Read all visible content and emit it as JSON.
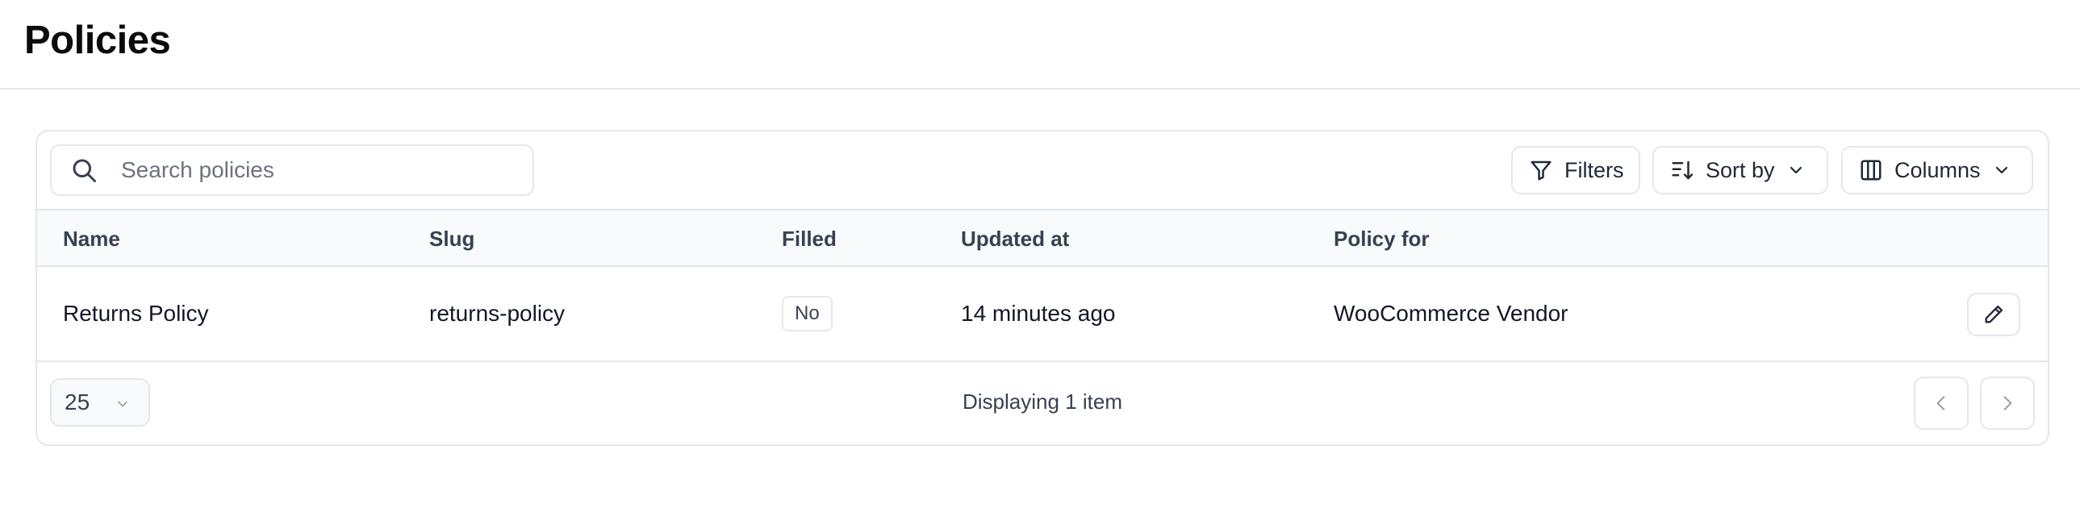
{
  "page": {
    "title": "Policies"
  },
  "toolbar": {
    "search_placeholder": "Search policies",
    "filters_label": "Filters",
    "sort_label": "Sort by",
    "columns_label": "Columns"
  },
  "table": {
    "columns": [
      "Name",
      "Slug",
      "Filled",
      "Updated at",
      "Policy for"
    ],
    "rows": [
      {
        "name": "Returns Policy",
        "slug": "returns-policy",
        "filled": "No",
        "updated_at": "14 minutes ago",
        "policy_for": "WooCommerce Vendor"
      }
    ]
  },
  "footer": {
    "per_page": "25",
    "count_text": "Displaying 1 item"
  },
  "icons": {
    "search": "search-icon",
    "filters": "filter-icon",
    "sort": "sort-icon",
    "columns": "columns-icon",
    "edit": "pencil-icon",
    "prev": "chevron-left-icon",
    "next": "chevron-right-icon"
  },
  "colors": {
    "border": "#e5e7eb",
    "header_bg": "#f9fafb",
    "text": "#111827",
    "muted": "#374151"
  }
}
